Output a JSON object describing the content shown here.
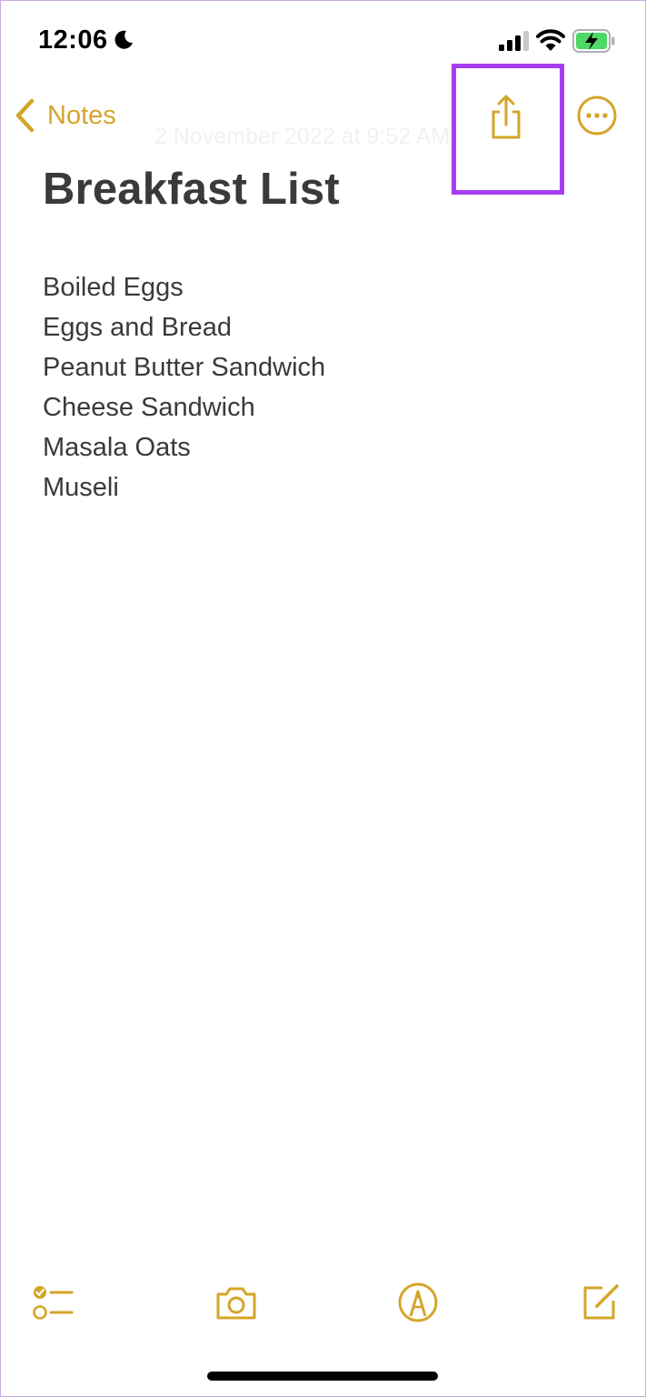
{
  "status_bar": {
    "time": "12:06",
    "focus_icon": "moon-icon",
    "signal_icon": "signal-icon",
    "wifi_icon": "wifi-icon",
    "battery_icon": "battery-charging-icon"
  },
  "nav": {
    "back_label": "Notes",
    "date": "2 November 2022 at 9:52 AM",
    "share_icon": "share-icon",
    "more_icon": "more-icon"
  },
  "note": {
    "title": "Breakfast List",
    "items": [
      "Boiled Eggs",
      "Eggs and Bread",
      "Peanut Butter Sandwich",
      "Cheese Sandwich",
      "Masala Oats",
      "Museli"
    ]
  },
  "toolbar": {
    "icons": [
      "checklist-icon",
      "camera-icon",
      "markup-icon",
      "compose-icon"
    ]
  },
  "colors": {
    "accent": "#d4a52a",
    "highlight": "#a63ef0",
    "text": "#3a3a3c",
    "battery_fill": "#4cd964"
  }
}
